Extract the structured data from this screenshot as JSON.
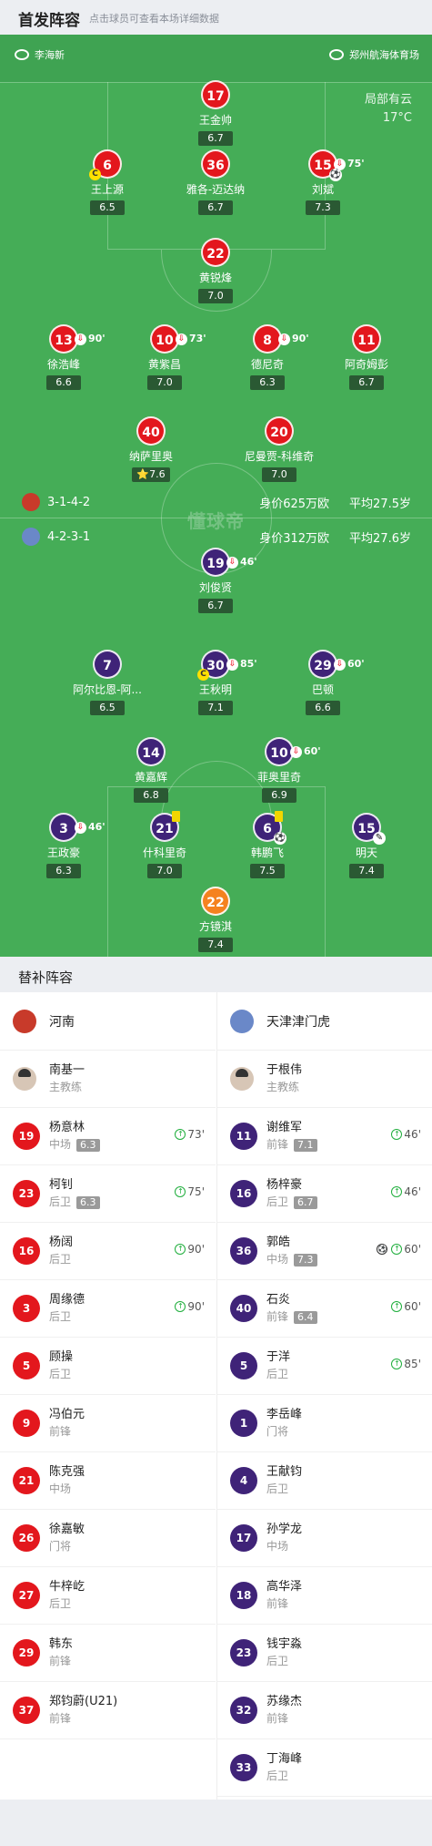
{
  "header": {
    "title": "首发阵容",
    "subtitle": "点击球员可查看本场详细数据"
  },
  "match": {
    "referee": "李海新",
    "venue": "郑州航海体育场",
    "weather": "局部有云",
    "temperature": "17°C",
    "watermark": "懂球帝"
  },
  "home": {
    "formation": "3-1-4-2",
    "value": "身价625万欧",
    "age": "平均27.5岁"
  },
  "away": {
    "formation": "4-2-3-1",
    "value": "身价312万欧",
    "age": "平均27.6岁"
  },
  "players": [
    {
      "num": "17",
      "name": "王金帅",
      "rating": "6.7",
      "team": "home"
    },
    {
      "num": "6",
      "name": "王上源",
      "rating": "6.5",
      "team": "home",
      "captain": "C"
    },
    {
      "num": "36",
      "name": "雅各-迈达纳",
      "rating": "6.7",
      "team": "home"
    },
    {
      "num": "15",
      "name": "刘斌",
      "rating": "7.3",
      "team": "home",
      "sub": "75'",
      "goal": true
    },
    {
      "num": "22",
      "name": "黄锐烽",
      "rating": "7.0",
      "team": "home"
    },
    {
      "num": "13",
      "name": "徐浩峰",
      "rating": "6.6",
      "team": "home",
      "sub": "90'"
    },
    {
      "num": "10",
      "name": "黄紫昌",
      "rating": "7.0",
      "team": "home",
      "sub": "73'"
    },
    {
      "num": "8",
      "name": "德尼奇",
      "rating": "6.3",
      "team": "home",
      "sub": "90'"
    },
    {
      "num": "11",
      "name": "阿奇姆彭",
      "rating": "6.7",
      "team": "home"
    },
    {
      "num": "40",
      "name": "纳萨里奥",
      "rating": "7.6",
      "team": "home",
      "star": "⭐"
    },
    {
      "num": "20",
      "name": "尼曼贾-科维奇",
      "rating": "7.0",
      "team": "home"
    },
    {
      "num": "19",
      "name": "刘俊贤",
      "rating": "6.7",
      "team": "away",
      "sub": "46'"
    },
    {
      "num": "7",
      "name": "阿尔比恩-阿...",
      "rating": "6.5",
      "team": "away"
    },
    {
      "num": "30",
      "name": "王秋明",
      "rating": "7.1",
      "team": "away",
      "sub": "85'",
      "captain": "C"
    },
    {
      "num": "29",
      "name": "巴顿",
      "rating": "6.6",
      "team": "away",
      "sub": "60'"
    },
    {
      "num": "14",
      "name": "黄嘉辉",
      "rating": "6.8",
      "team": "away"
    },
    {
      "num": "10",
      "name": "菲奥里奇",
      "rating": "6.9",
      "team": "away",
      "sub": "60'"
    },
    {
      "num": "3",
      "name": "王政豪",
      "rating": "6.3",
      "team": "away",
      "sub": "46'"
    },
    {
      "num": "21",
      "name": "什科里奇",
      "rating": "7.0",
      "team": "away",
      "yellow": true
    },
    {
      "num": "6",
      "name": "韩鹏飞",
      "rating": "7.5",
      "team": "away",
      "yellow": true,
      "goal": true
    },
    {
      "num": "15",
      "name": "明天",
      "rating": "7.4",
      "team": "away",
      "assist": true
    },
    {
      "num": "22",
      "name": "方镜淇",
      "rating": "7.4",
      "team": "keeper"
    }
  ],
  "bench": {
    "title": "替补阵容",
    "home_team": "河南",
    "away_team": "天津津门虎",
    "home_coach": {
      "name": "南基一",
      "role": "主教练"
    },
    "away_coach": {
      "name": "于根伟",
      "role": "主教练"
    },
    "home_players": [
      {
        "num": "19",
        "name": "杨意林",
        "pos": "中场",
        "rating": "6.3",
        "in": "73'"
      },
      {
        "num": "23",
        "name": "柯钊",
        "pos": "后卫",
        "rating": "6.3",
        "in": "75'"
      },
      {
        "num": "16",
        "name": "杨阔",
        "pos": "后卫",
        "in": "90'"
      },
      {
        "num": "3",
        "name": "周缘德",
        "pos": "后卫",
        "in": "90'"
      },
      {
        "num": "5",
        "name": "顾操",
        "pos": "后卫"
      },
      {
        "num": "9",
        "name": "冯伯元",
        "pos": "前锋"
      },
      {
        "num": "21",
        "name": "陈克强",
        "pos": "中场"
      },
      {
        "num": "26",
        "name": "徐嘉敏",
        "pos": "门将"
      },
      {
        "num": "27",
        "name": "牛梓屹",
        "pos": "后卫"
      },
      {
        "num": "29",
        "name": "韩东",
        "pos": "前锋"
      },
      {
        "num": "37",
        "name": "郑钧蔚(U21)",
        "pos": "前锋"
      }
    ],
    "away_players": [
      {
        "num": "11",
        "name": "谢维军",
        "pos": "前锋",
        "rating": "7.1",
        "in": "46'"
      },
      {
        "num": "16",
        "name": "杨梓豪",
        "pos": "后卫",
        "rating": "6.7",
        "in": "46'"
      },
      {
        "num": "36",
        "name": "郭皓",
        "pos": "中场",
        "rating": "7.3",
        "in": "60'",
        "goal": true
      },
      {
        "num": "40",
        "name": "石炎",
        "pos": "前锋",
        "rating": "6.4",
        "in": "60'"
      },
      {
        "num": "5",
        "name": "于洋",
        "pos": "后卫",
        "in": "85'"
      },
      {
        "num": "1",
        "name": "李岳峰",
        "pos": "门将"
      },
      {
        "num": "4",
        "name": "王献钧",
        "pos": "后卫"
      },
      {
        "num": "17",
        "name": "孙学龙",
        "pos": "中场"
      },
      {
        "num": "18",
        "name": "高华泽",
        "pos": "前锋"
      },
      {
        "num": "23",
        "name": "钱宇淼",
        "pos": "后卫"
      },
      {
        "num": "32",
        "name": "苏缘杰",
        "pos": "前锋"
      },
      {
        "num": "33",
        "name": "丁海峰",
        "pos": "后卫"
      }
    ]
  },
  "colors": {
    "home": "#e3171d",
    "away": "#3f2378",
    "keeper": "#f5821f",
    "pitch": "#45ad57"
  }
}
